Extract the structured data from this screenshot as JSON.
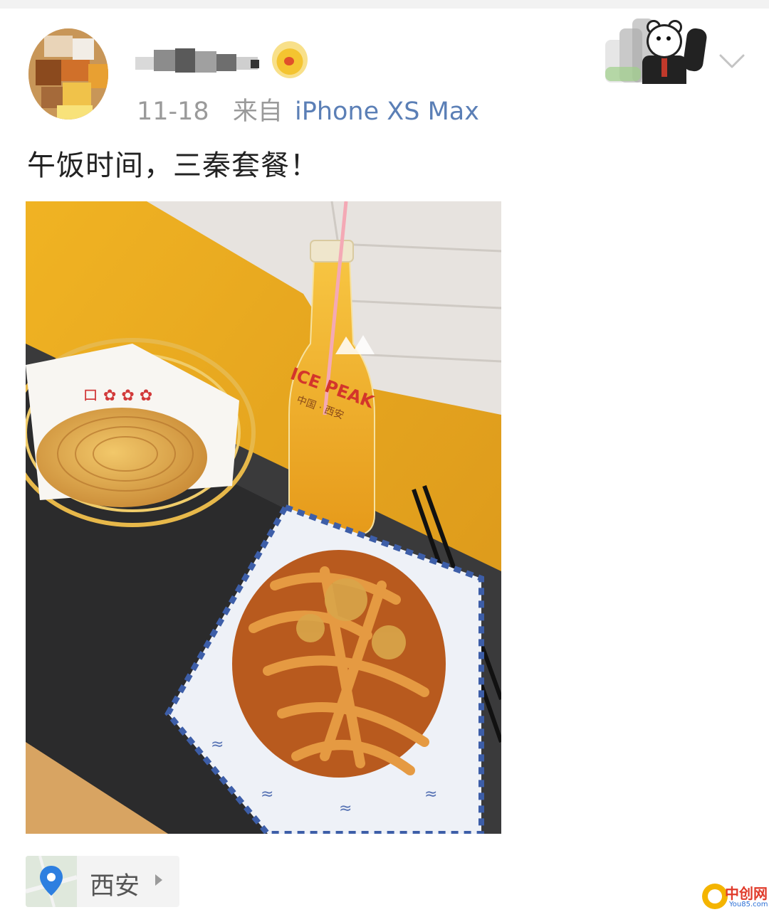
{
  "post": {
    "date": "11-18",
    "from_label": "来自",
    "source": "iPhone XS Max",
    "text": "午饭时间，三秦套餐！"
  },
  "photo": {
    "bottle_brand": "ICE PEAK",
    "bottle_subtext": "中国 · 西安"
  },
  "location": {
    "label": "西安",
    "icon": "location-pin-icon"
  },
  "watermark": {
    "brand": "中创网",
    "domain": "You85.com"
  },
  "colors": {
    "source_link": "#5b7fb6",
    "meta_gray": "#9a9a9a",
    "location_pin": "#2d7fe0",
    "watermark_red": "#e03a2a"
  }
}
